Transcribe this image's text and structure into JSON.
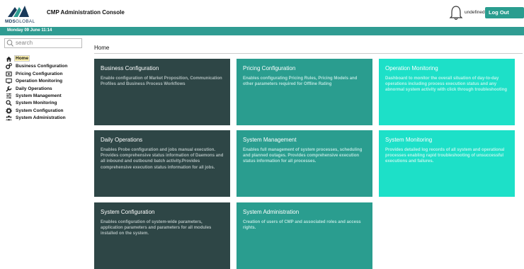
{
  "header": {
    "logo_text_bold": "MDS",
    "logo_text_thin": "GLOBAL",
    "app_title": "CMP Administration Console",
    "user": "undefined",
    "logout_label": "Log Out"
  },
  "date_bar": {
    "text": "Monday 09 June 11:14"
  },
  "sidebar": {
    "search_placeholder": "search",
    "items": [
      {
        "label": "Home",
        "icon": "home-icon",
        "active": true
      },
      {
        "label": "Business Configuration",
        "icon": "cogs-icon"
      },
      {
        "label": "Pricing Configuration",
        "icon": "price-tag-icon"
      },
      {
        "label": "Operation Monitoring",
        "icon": "monitor-icon"
      },
      {
        "label": "Daily Operations",
        "icon": "wrench-icon"
      },
      {
        "label": "System Management",
        "icon": "sliders-icon"
      },
      {
        "label": "System Monitoring",
        "icon": "search-icon"
      },
      {
        "label": "System Configuration",
        "icon": "gear-icon"
      },
      {
        "label": "System Administration",
        "icon": "users-icon"
      }
    ]
  },
  "main": {
    "title": "Home",
    "cards": [
      {
        "title": "Business Configuration",
        "desc": "Enable configuration of Market Proposition, Communication Profiles and Business Process Workflows",
        "style": "dark"
      },
      {
        "title": "Pricing Configuration",
        "desc": "Enables configurating Pricing Rules, Pricing Models and other parameters required for Offline Rating",
        "style": "mid"
      },
      {
        "title": "Operation Monitoring",
        "desc": "Dashboard to monitor the overall situation of day-to-day operations including process execution status and any abnormal system activity with click through troubleshooting",
        "style": "light"
      },
      {
        "title": "Daily Operations",
        "desc": "Enables Probe configuration and jobs manual execution. Provides comprehensive status information of Daemons and all inbound and outbound batch activity.Provides comprehensive execution status information for all jobs.",
        "style": "dark"
      },
      {
        "title": "System Management",
        "desc": "Enables full management of system processes, scheduling and planned outages. Provides comprehensive execution status information for all processes.",
        "style": "mid"
      },
      {
        "title": "System Monitoring",
        "desc": "Provides detailed log records of all system and operational processes enabling rapid troubleshooting of unsuccessful executions and failures.",
        "style": "light"
      },
      {
        "title": "System Configuration",
        "desc": "Enables configuration of system-wide parameters, application parameters and parameters for all modules installed on the system.",
        "style": "dark"
      },
      {
        "title": "System Administration",
        "desc": "Creation of users of CMP and associated roles and access rights.",
        "style": "mid"
      }
    ]
  },
  "colors": {
    "accent": "#2f9c92",
    "card_dark": "#2e4646",
    "card_mid": "#2a9d8f",
    "card_light": "#1de0c8"
  }
}
